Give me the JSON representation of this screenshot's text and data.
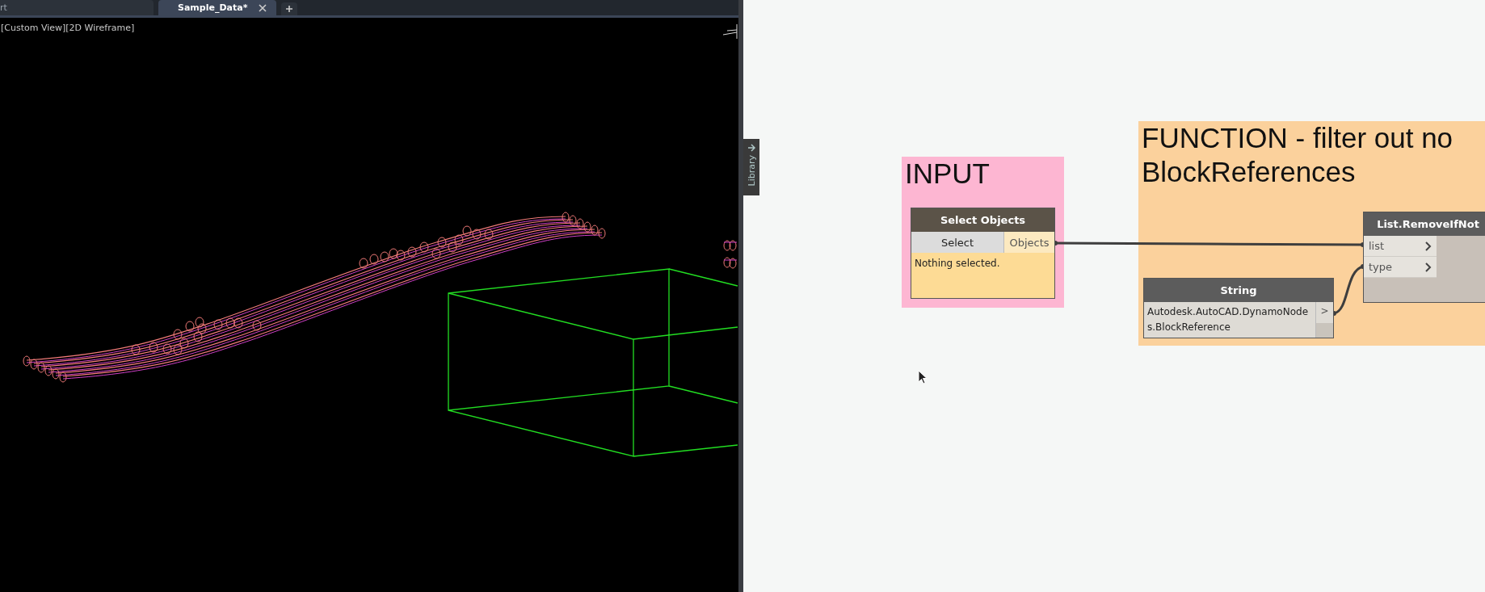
{
  "cad": {
    "tabs": [
      {
        "label": "rt",
        "selected": false
      },
      {
        "label": "Sample_Data*",
        "selected": true
      }
    ],
    "viewport_label": "[Custom View][2D Wireframe]"
  },
  "library_tab": {
    "label": "Library"
  },
  "groups": [
    {
      "title_lines": [
        "INPUT"
      ],
      "color": "#fdb6d2"
    },
    {
      "title_lines": [
        "FUNCTION - filter out no",
        "BlockReferences"
      ],
      "color": "#fbd19c"
    }
  ],
  "select_node": {
    "title": "Select Objects",
    "button": "Select",
    "output": "Objects",
    "message": "Nothing selected."
  },
  "string_node": {
    "title": "String",
    "value": "Autodesk.AutoCAD.DynamoNodes.BlockReference",
    "output": ">"
  },
  "list_node": {
    "title": "List.RemoveIfNot",
    "inputs": [
      "list",
      "type"
    ]
  }
}
